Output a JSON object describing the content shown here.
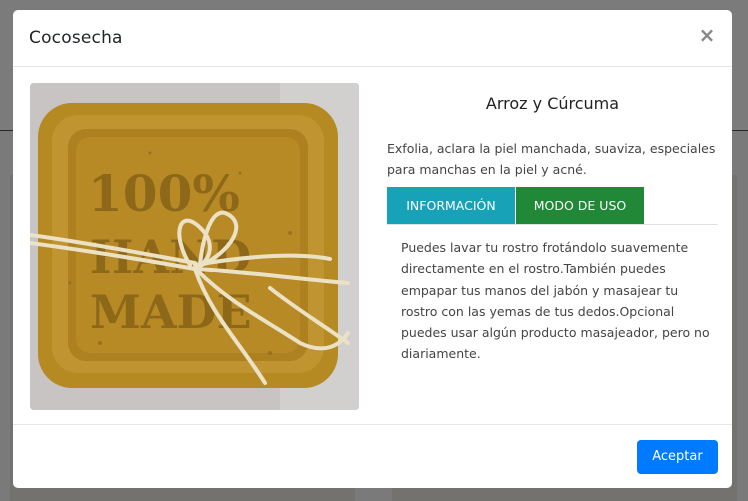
{
  "modal": {
    "title": "Cocosecha",
    "close_symbol": "×"
  },
  "product": {
    "image_icon": "soap-product-photo",
    "name": "Arroz y Cúrcuma",
    "description": "Exfolia, aclara la piel manchada, suaviza, especiales para manchas en la piel y acné."
  },
  "tabs": [
    {
      "label": "INFORMACIÓN",
      "color": "#17a2b8"
    },
    {
      "label": "MODO DE USO",
      "color": "#218838"
    }
  ],
  "tab_content": "Puedes lavar tu rostro frotándolo suavemente directamente en el rostro.También puedes empapar tus manos del jabón y masajear tu rostro con las yemas de tus dedos.Opcional puedes usar algún producto masajeador, pero no diariamente.",
  "footer": {
    "accept_label": "Aceptar",
    "accept_color": "#007bff"
  }
}
